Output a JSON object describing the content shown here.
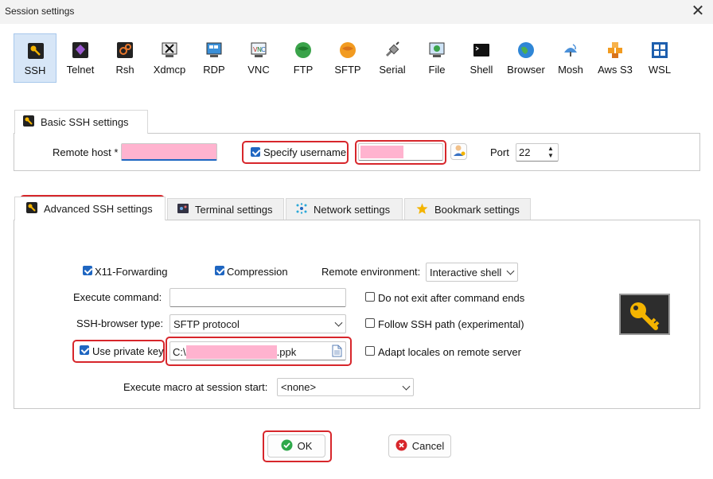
{
  "window": {
    "title": "Session settings",
    "close_glyph": "✕"
  },
  "session_types": [
    {
      "label": "SSH",
      "icon": "key-icon"
    },
    {
      "label": "Telnet",
      "icon": "telnet-icon"
    },
    {
      "label": "Rsh",
      "icon": "rsh-icon"
    },
    {
      "label": "Xdmcp",
      "icon": "xdmcp-icon"
    },
    {
      "label": "RDP",
      "icon": "rdp-icon"
    },
    {
      "label": "VNC",
      "icon": "vnc-icon"
    },
    {
      "label": "FTP",
      "icon": "ftp-icon"
    },
    {
      "label": "SFTP",
      "icon": "sftp-icon"
    },
    {
      "label": "Serial",
      "icon": "serial-icon"
    },
    {
      "label": "File",
      "icon": "file-icon"
    },
    {
      "label": "Shell",
      "icon": "shell-icon"
    },
    {
      "label": "Browser",
      "icon": "browser-icon"
    },
    {
      "label": "Mosh",
      "icon": "mosh-icon"
    },
    {
      "label": "Aws S3",
      "icon": "aws-s3-icon"
    },
    {
      "label": "WSL",
      "icon": "wsl-icon"
    }
  ],
  "selected_session_type": "SSH",
  "basic": {
    "tab_label": "Basic SSH settings",
    "remote_host_label": "Remote host *",
    "remote_host_value": "",
    "specify_username_label": "Specify username",
    "specify_username_checked": true,
    "username_value": "",
    "port_label": "Port",
    "port_value": "22"
  },
  "tabs": [
    {
      "label": "Advanced SSH settings",
      "icon": "key-icon"
    },
    {
      "label": "Terminal settings",
      "icon": "terminal-icon"
    },
    {
      "label": "Network settings",
      "icon": "network-icon"
    },
    {
      "label": "Bookmark settings",
      "icon": "star-icon"
    }
  ],
  "advanced": {
    "x11_label": "X11-Forwarding",
    "x11_checked": true,
    "compression_label": "Compression",
    "compression_checked": true,
    "remote_env_label": "Remote environment:",
    "remote_env_value": "Interactive shell",
    "execute_command_label": "Execute command:",
    "execute_command_value": "",
    "no_exit_label": "Do not exit after command ends",
    "no_exit_checked": false,
    "browser_type_label": "SSH-browser type:",
    "browser_type_value": "SFTP protocol",
    "follow_path_label": "Follow SSH path (experimental)",
    "follow_path_checked": false,
    "private_key_label": "Use private key",
    "private_key_checked": true,
    "private_key_prefix": "C:\\",
    "private_key_suffix": ".ppk",
    "adapt_locales_label": "Adapt locales on remote server",
    "adapt_locales_checked": false,
    "macro_label": "Execute macro at session start:",
    "macro_value": "<none>"
  },
  "buttons": {
    "ok": "OK",
    "cancel": "Cancel"
  },
  "colors": {
    "accent": "#1f66c1",
    "highlight": "#d7262b",
    "redacted": "#ffb3cf",
    "selected_bg": "#d7e6f7"
  }
}
